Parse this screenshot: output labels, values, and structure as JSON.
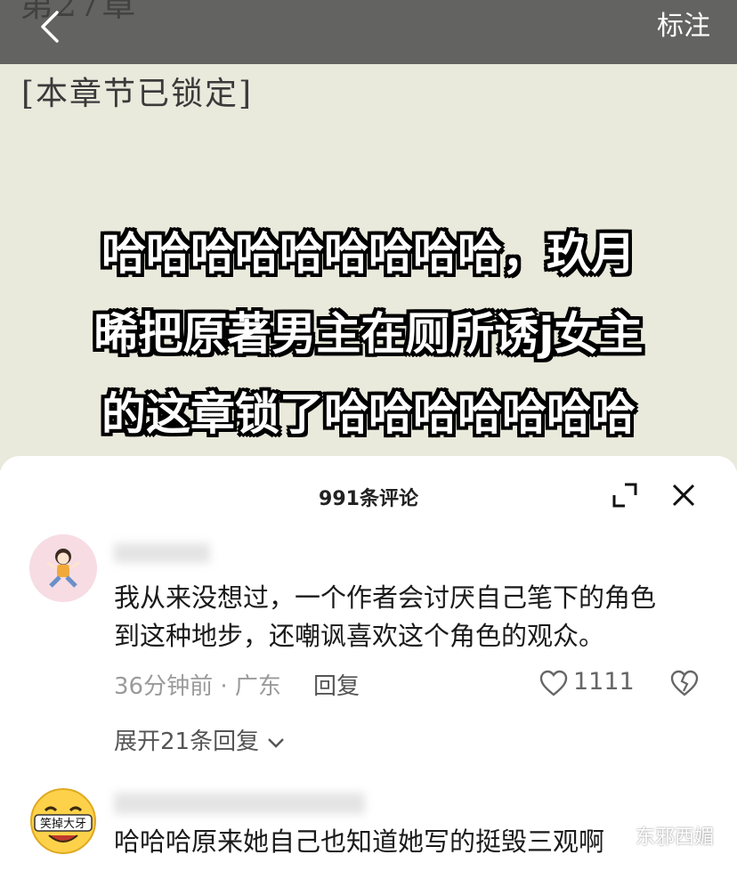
{
  "video": {
    "locked_label": "[本章节已锁定]",
    "caption_lines": [
      "哈哈哈哈哈哈哈哈哈，玖月",
      "晞把原著男主在厕所诱j女主",
      "的这章锁了哈哈哈哈哈哈哈"
    ]
  },
  "topbar": {
    "mark_label": "标注"
  },
  "comments_panel": {
    "title": "991条评论",
    "comments": [
      {
        "text_line1": "我从来没想过，一个作者会讨厌自己笔下的角色",
        "text_line2": "到这种地步，还嘲讽喜欢这个角色的观众。",
        "time_location": "36分钟前 · 广东",
        "reply_label": "回复",
        "like_count": "1111",
        "expand_label": "展开21条回复"
      },
      {
        "avatar_text": "笑掉大牙",
        "text_line1": "哈哈哈原来她自己也知道她写的挺毁三观啊"
      }
    ]
  },
  "watermark": "东邪西媚",
  "colors": {
    "video_bg": "#e9e9dc",
    "topbar": "#464646",
    "text": "#1a1a1a",
    "meta": "#9a9a9a"
  }
}
